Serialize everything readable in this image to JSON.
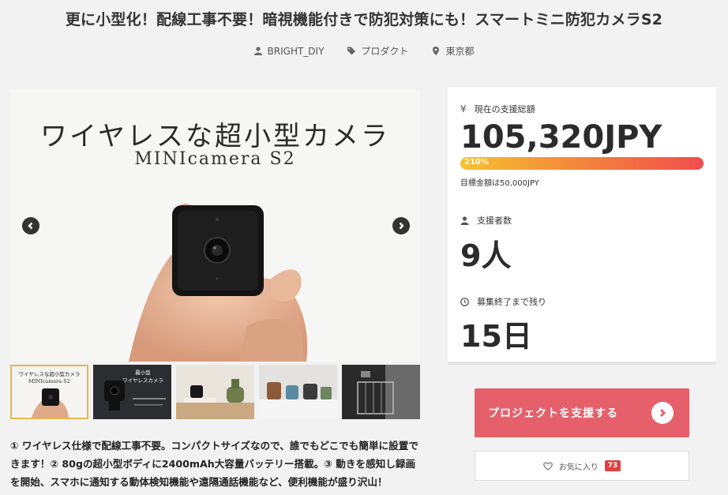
{
  "title": "更に小型化！配線工事不要！暗視機能付きで防犯対策にも！スマートミニ防犯カメラS2",
  "meta": {
    "owner": "BRIGHT_DIY",
    "category": "プロダクト",
    "location": "東京都"
  },
  "slide": {
    "heading": "ワイヤレスな超小型カメラ",
    "subheading": "MINIcamera S2"
  },
  "thumbnails": [
    {
      "heading": "ワイヤレスな超小型カメラ",
      "sub": "MINIcamera S2"
    },
    {
      "heading": "最小型",
      "sub": "ワイヤレスカメラ"
    },
    {
      "heading": "",
      "sub": ""
    },
    {
      "heading": "",
      "sub": ""
    },
    {
      "heading": "",
      "sub": ""
    }
  ],
  "description": "① ワイヤレス仕様で配線工事不要。コンパクトサイズなので、誰でもどこでも簡単に設置できます！② 80gの超小型ボディに2400mAh大容量バッテリー搭載。③ 動きを感知し録画を開始、スマホに通知する動体検知機能や遠隔通話機能など、便利機能が盛り沢山！",
  "stats": {
    "funding_label": "現在の支援総額",
    "funding_amount": "105,320JPY",
    "progress_text": "210%",
    "progress_percent": 210,
    "goal_text": "目標金額は50,000JPY",
    "supporters_label": "支援者数",
    "supporters_value": "9人",
    "remaining_label": "募集終了まで残り",
    "remaining_value": "15日"
  },
  "buttons": {
    "support": "プロジェクトを支援する",
    "favorite": "お気に入り",
    "favorite_count": "73"
  },
  "colors": {
    "accent": "#e5606a",
    "badge": "#e0403f",
    "progress_start": "#f6c233",
    "progress_end": "#f04d4d"
  }
}
